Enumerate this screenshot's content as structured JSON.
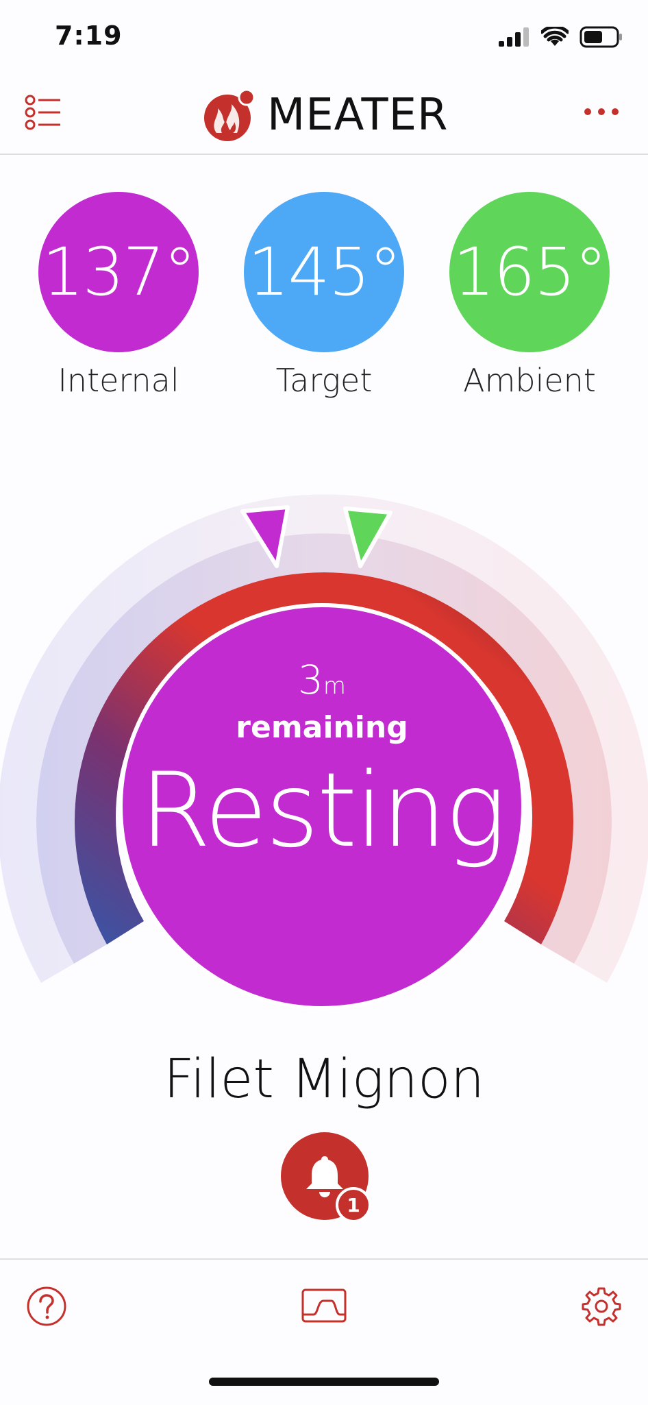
{
  "status_bar": {
    "time": "7:19",
    "icons": [
      "signal-icon",
      "wifi-icon",
      "battery-icon"
    ]
  },
  "header": {
    "brand": "MEATER",
    "logo_icon": "flame-logo-icon",
    "menu_icon": "list-icon",
    "more_icon": "more-dots-icon"
  },
  "temps": {
    "internal": {
      "value": "137°",
      "label": "Internal",
      "color": "#c22bd0"
    },
    "target": {
      "value": "145°",
      "label": "Target",
      "color": "#4da8f5"
    },
    "ambient": {
      "value": "165°",
      "label": "Ambient",
      "color": "#5fd65a"
    }
  },
  "gauge": {
    "time_value": "3",
    "time_unit": "m",
    "remaining_label": "remaining",
    "status": "Resting",
    "internal_marker_color": "#c22bd0",
    "target_marker_color": "#5fd65a"
  },
  "meat": {
    "name": "Filet Mignon"
  },
  "alerts": {
    "count": "1",
    "icon": "bell-icon"
  },
  "bottom_bar": {
    "help_icon": "help-icon",
    "graph_icon": "graph-icon",
    "settings_icon": "gear-icon"
  },
  "colors": {
    "accent": "#c4302b",
    "background": "#fdfcfe"
  }
}
